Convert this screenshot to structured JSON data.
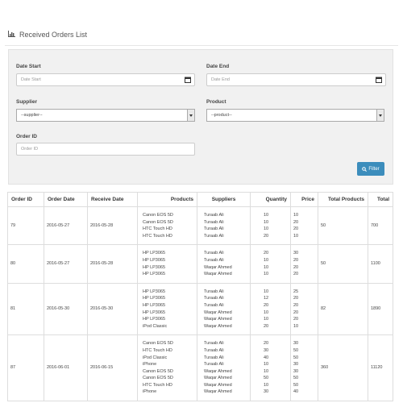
{
  "page": {
    "title": "Received Orders List",
    "icon": "bar-chart-icon"
  },
  "filters": {
    "date_start_label": "Date Start",
    "date_start_placeholder": "Date Start",
    "date_end_label": "Date End",
    "date_end_placeholder": "Date End",
    "supplier_label": "Supplier",
    "supplier_value": "--supplier--",
    "product_label": "Product",
    "product_value": "--product--",
    "order_id_label": "Order ID",
    "order_id_placeholder": "Order ID",
    "filter_button": "Filter"
  },
  "table": {
    "headers": [
      "Order ID",
      "Order Date",
      "Receive Date",
      "Products",
      "Suppliers",
      "Quantity",
      "Price",
      "Total Products",
      "Total"
    ],
    "rows": [
      {
        "order_id": "79",
        "order_date": "2016-05-27",
        "receive_date": "2016-05-28",
        "products": "Canon EOS 5D\nCanon EOS 5D\nHTC Touch HD\nHTC Touch HD",
        "suppliers": "Turaab Ali\nTuraab Ali\nTuraab Ali\nTuraab Ali",
        "quantity": "10\n10\n10\n20",
        "price": "10\n20\n20\n10",
        "total_products": "50",
        "total": "700"
      },
      {
        "order_id": "80",
        "order_date": "2016-05-27",
        "receive_date": "2016-05-28",
        "products": "HP LP3065\nHP LP3065\nHP LP3065\nHP LP3065",
        "suppliers": "Turaab Ali\nTuraab Ali\nWaqar Ahmed\nWaqar Ahmed",
        "quantity": "20\n10\n10\n10",
        "price": "30\n20\n20\n20",
        "total_products": "50",
        "total": "1100"
      },
      {
        "order_id": "81",
        "order_date": "2016-05-30",
        "receive_date": "2016-05-30",
        "products": "HP LP3065\nHP LP3065\nHP LP3065\nHP LP3065\nHP LP3065\niPod Classic",
        "suppliers": "Turaab Ali\nTuraab Ali\nTuraab Ali\nWaqar Ahmed\nWaqar Ahmed\nWaqar Ahmed",
        "quantity": "10\n12\n20\n10\n10\n20",
        "price": "25\n20\n20\n20\n20\n10",
        "total_products": "82",
        "total": "1890"
      },
      {
        "order_id": "87",
        "order_date": "2016-06-01",
        "receive_date": "2016-06-15",
        "products": "Canon EOS 5D\nHTC Touch HD\niPod Classic\niPhone\nCanon EOS 5D\nCanon EOS 5D\nHTC Touch HD\niPhone",
        "suppliers": "Turaab Ali\nTuraab Ali\nTuraab Ali\nTuraab Ali\nWaqar Ahmed\nWaqar Ahmed\nWaqar Ahmed\nWaqar Ahmed",
        "quantity": "20\n30\n40\n10\n10\n50\n10\n30",
        "price": "30\n50\n50\n30\n30\n50\n50\n40",
        "total_products": "360",
        "total": "11120"
      }
    ]
  }
}
